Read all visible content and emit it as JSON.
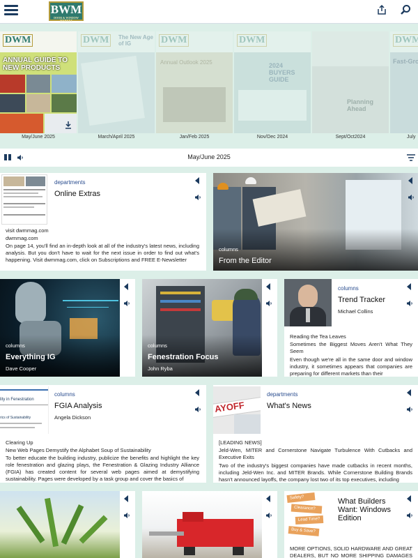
{
  "header": {
    "logo_text": "BWM",
    "logo_subtext": "DOOR & WINDOW MARKET"
  },
  "issues": [
    {
      "label": "May/June 2025",
      "cover_text": "ANNUAL GUIDE TO NEW PRODUCTS"
    },
    {
      "label": "March/April 2025",
      "cover_text": "The New Age of IG"
    },
    {
      "label": "Jan/Feb 2025",
      "cover_text": "Annual Outlook 2025"
    },
    {
      "label": "Nov/Dec 2024",
      "cover_text": "2024 BUYERS GUIDE"
    },
    {
      "label": "Sept/Oct2024",
      "cover_text": "Planning Ahead"
    },
    {
      "label": "July",
      "cover_text": "Fast-Grow"
    }
  ],
  "issue_bar": {
    "title": "May/June 2025"
  },
  "articles": {
    "online_extras": {
      "category": "departments",
      "title": "Online Extras",
      "line1": "visit dwmmag.com",
      "line2": "dwmmag.com",
      "body": "On page 14, you'll find an in-depth look at all of the industry's latest news, including analysis. But you don't have to wait for the next issue in order to find out what's happening. Visit dwmmag.com, click on Subscriptions and FREE E-Newsletter"
    },
    "from_editor": {
      "category": "columns",
      "title": "From the Editor"
    },
    "everything_ig": {
      "category": "columns",
      "title": "Everything IG",
      "author": "Dave Cooper"
    },
    "fenestration_focus": {
      "category": "columns",
      "title": "Fenestration Focus",
      "author": "John Ryba"
    },
    "trend_tracker": {
      "category": "columns",
      "title": "Trend Tracker",
      "author": "Michael Collins",
      "kicker": "Reading the Tea Leaves",
      "deck": "Sometimes the Biggest Moves Aren't What They Seem",
      "body": "Even though we're all in the same door and window industry, it sometimes appears that companies are preparing for different markets than their"
    },
    "fgia_analysis": {
      "category": "columns",
      "title": "FGIA Analysis",
      "author": "Angela Dickson",
      "kicker": "Clearing Up",
      "deck": "New Web Pages Demystify the Alphabet Soup of Sustainability",
      "body": "To better educate the building industry, publicize the benefits and highlight the key role fenestration and glazing plays, the Fenestration & Glazing Industry Alliance (FGIA) has created content for several web pages aimed at demystifying sustainability. Pages were developed by a task group and cover the basics of"
    },
    "whats_news": {
      "category": "departments",
      "title": "What's News",
      "kicker": "[LEADING NEWS]",
      "deck": "Jeld-Wen, MITER and Cornerstone Navigate Turbulence With Cutbacks and Executive Exits",
      "body": "Two of the industry's biggest companies have made cutbacks in recent months, including Jeld-Wen Inc. and MITER Brands. While Cornerstone Building Brands hasn't announced layoffs, the company lost two of its top executives, including"
    },
    "what_builders_want": {
      "title": "What Builders Want: Windows Edition",
      "body": "MORE OPTIONS, SOLID HARDWARE AND GREAT DEALERS, BUT NO MORE SHIPPING DAMAGES OR"
    }
  },
  "thumb_text": {
    "fgia_thumb": "lity in Fenestration",
    "fgia_thumb2": "rics of Sustainability",
    "layoff": "AYOFF",
    "sticky": [
      "Safety?",
      "Clearance?",
      "Lead Time?",
      "Buy & Save?"
    ]
  }
}
